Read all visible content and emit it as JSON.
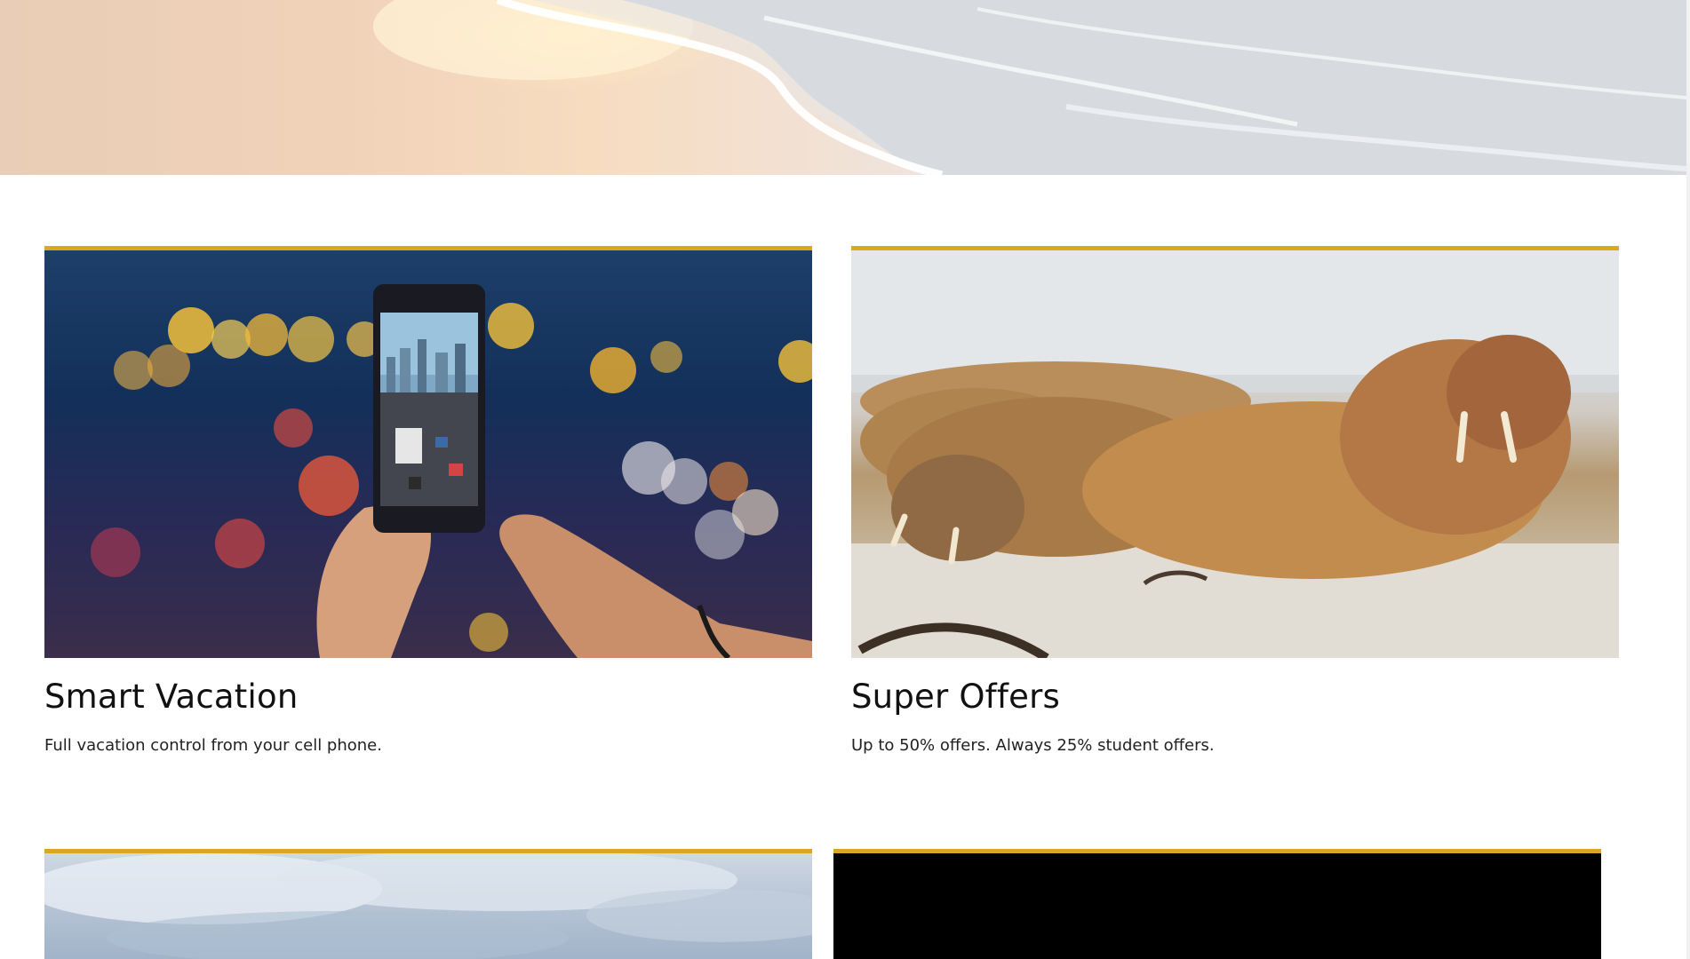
{
  "hero": {
    "alt": "beach-shoreline-photo"
  },
  "cards": [
    {
      "title": "Smart Vacation",
      "text": "Full vacation control from your cell phone.",
      "image": "phone-city-traffic-photo"
    },
    {
      "title": "Super Offers",
      "text": "Up to 50% offers. Always 25% student offers.",
      "image": "walrus-beach-photo"
    },
    {
      "title": "",
      "text": "",
      "image": "cloudy-sky-photo"
    },
    {
      "title": "",
      "text": "",
      "image": "black-video-frame"
    }
  ],
  "colors": {
    "accent": "#d9a820",
    "text": "#111111",
    "background": "#ffffff"
  }
}
